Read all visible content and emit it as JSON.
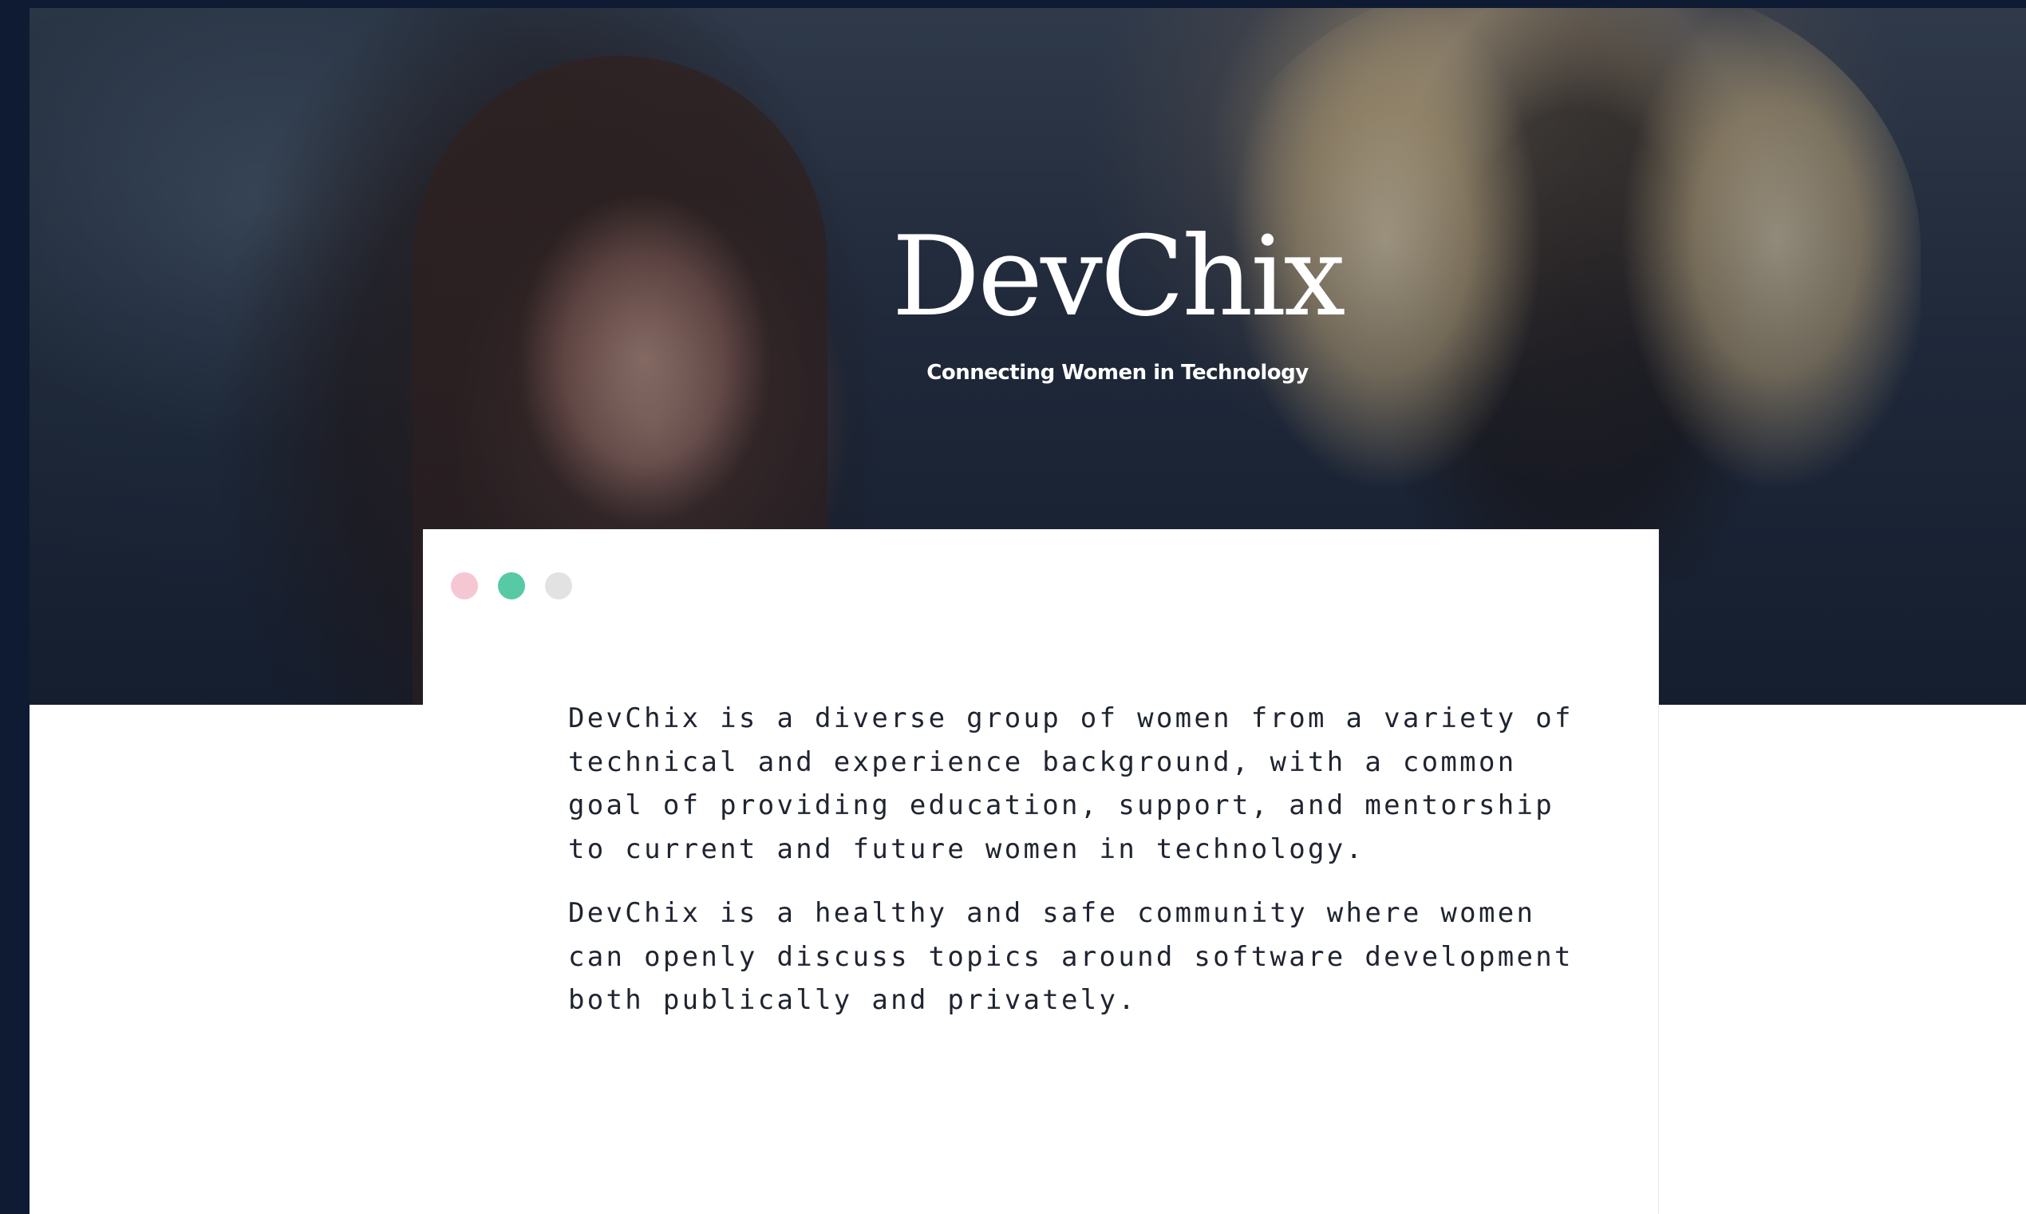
{
  "hero": {
    "title": "DevChix",
    "tagline": "Connecting Women in Technology"
  },
  "card": {
    "window_dots": [
      {
        "name": "pink-dot",
        "color": "#f4c7d3"
      },
      {
        "name": "green-dot",
        "color": "#57c9a4"
      },
      {
        "name": "grey-dot",
        "color": "#e2e2e2"
      }
    ],
    "paragraphs": [
      "DevChix is a diverse group of women from a variety of technical and experience background, with a common goal of providing education, support, and mentorship to current and future women in technology.",
      "DevChix is a healthy and safe community where women can openly discuss topics around software development both publically and privately."
    ]
  },
  "colors": {
    "background": "#0f1b33",
    "card": "#ffffff",
    "text": "#1f2430"
  }
}
